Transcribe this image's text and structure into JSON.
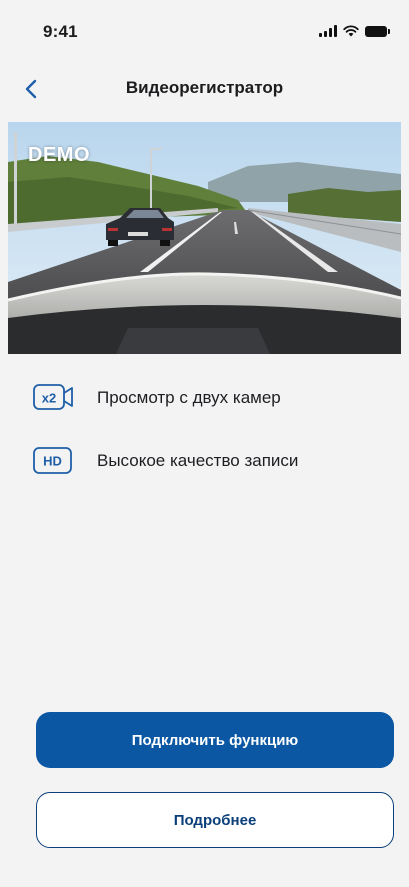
{
  "status_bar": {
    "time": "9:41",
    "icons": [
      "cellular-signal-icon",
      "wifi-icon",
      "battery-icon"
    ]
  },
  "nav": {
    "back_icon": "chevron-left-icon",
    "title": "Видеорегистратор"
  },
  "preview": {
    "badge": "DEMO"
  },
  "features": [
    {
      "icon_text": "x2",
      "icon": "dual-camera-icon",
      "label": "Просмотр с двух камер"
    },
    {
      "icon_text": "HD",
      "icon": "hd-quality-icon",
      "label": "Высокое качество записи"
    }
  ],
  "actions": {
    "primary_label": "Подключить функцию",
    "secondary_label": "Подробнее"
  },
  "colors": {
    "accent": "#0b57a4",
    "accent_dark": "#0b3f7a",
    "background": "#f3f3f4"
  }
}
